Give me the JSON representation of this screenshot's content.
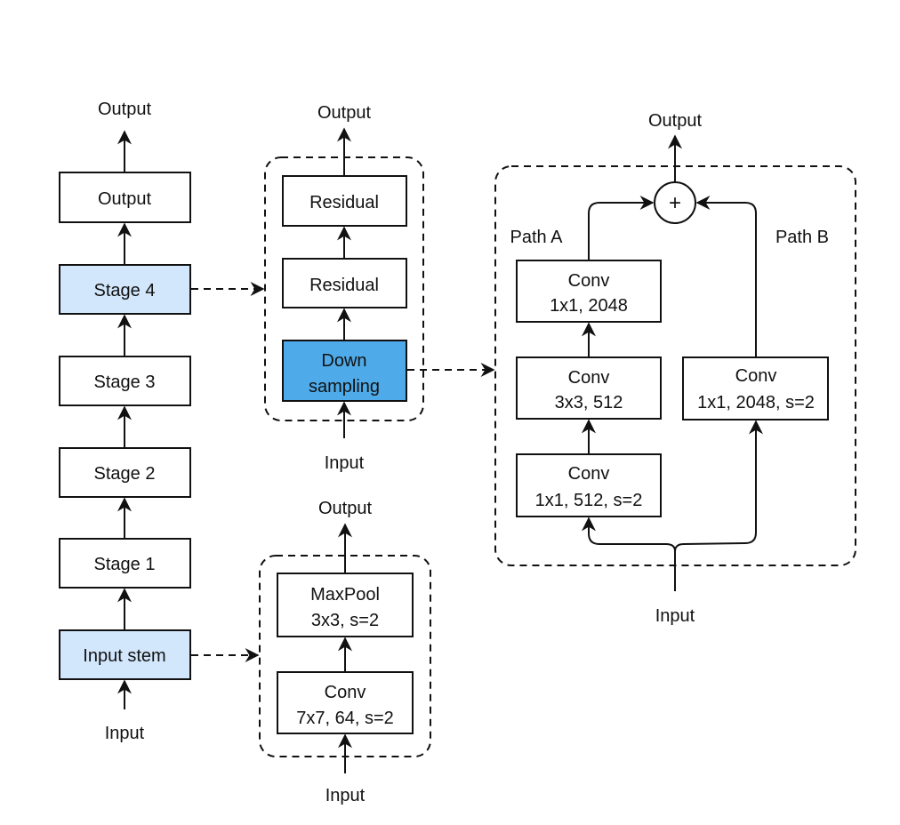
{
  "colors": {
    "light_blue": "#d2e7fc",
    "dark_blue": "#4eaae8",
    "white": "#ffffff",
    "stroke": "#111111"
  },
  "left": {
    "output_label": "Output",
    "input_label": "Input",
    "blocks": [
      "Output",
      "Stage 4",
      "Stage 3",
      "Stage 2",
      "Stage 1",
      "Input stem"
    ]
  },
  "stage": {
    "output_label": "Output",
    "input_label": "Input",
    "residual_1": "Residual",
    "residual_2": "Residual",
    "down_line1": "Down",
    "down_line2": "sampling"
  },
  "stem": {
    "output_label": "Output",
    "input_label": "Input",
    "maxpool_line1": "MaxPool",
    "maxpool_line2": "3x3, s=2",
    "conv_line1": "Conv",
    "conv_line2": "7x7, 64, s=2"
  },
  "downsampling": {
    "output_label": "Output",
    "input_label": "Input",
    "plus": "+",
    "path_a": "Path A",
    "path_b": "Path B",
    "a_top_line1": "Conv",
    "a_top_line2": "1x1, 2048",
    "a_mid_line1": "Conv",
    "a_mid_line2": "3x3, 512",
    "a_bot_line1": "Conv",
    "a_bot_line2": "1x1, 512, s=2",
    "b_line1": "Conv",
    "b_line2": "1x1, 2048, s=2"
  }
}
